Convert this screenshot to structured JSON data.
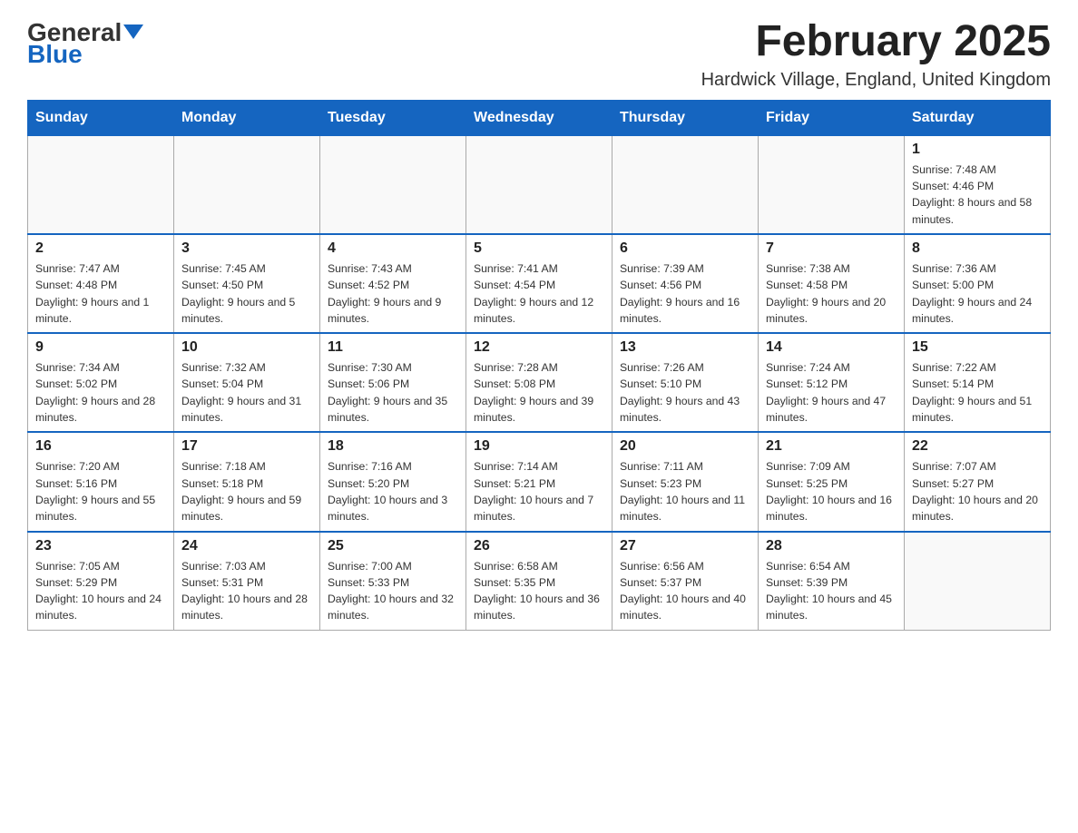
{
  "header": {
    "logo_general": "General",
    "logo_blue": "Blue",
    "month_title": "February 2025",
    "location": "Hardwick Village, England, United Kingdom"
  },
  "days_of_week": [
    "Sunday",
    "Monday",
    "Tuesday",
    "Wednesday",
    "Thursday",
    "Friday",
    "Saturday"
  ],
  "weeks": [
    [
      {
        "day": "",
        "info": ""
      },
      {
        "day": "",
        "info": ""
      },
      {
        "day": "",
        "info": ""
      },
      {
        "day": "",
        "info": ""
      },
      {
        "day": "",
        "info": ""
      },
      {
        "day": "",
        "info": ""
      },
      {
        "day": "1",
        "info": "Sunrise: 7:48 AM\nSunset: 4:46 PM\nDaylight: 8 hours and 58 minutes."
      }
    ],
    [
      {
        "day": "2",
        "info": "Sunrise: 7:47 AM\nSunset: 4:48 PM\nDaylight: 9 hours and 1 minute."
      },
      {
        "day": "3",
        "info": "Sunrise: 7:45 AM\nSunset: 4:50 PM\nDaylight: 9 hours and 5 minutes."
      },
      {
        "day": "4",
        "info": "Sunrise: 7:43 AM\nSunset: 4:52 PM\nDaylight: 9 hours and 9 minutes."
      },
      {
        "day": "5",
        "info": "Sunrise: 7:41 AM\nSunset: 4:54 PM\nDaylight: 9 hours and 12 minutes."
      },
      {
        "day": "6",
        "info": "Sunrise: 7:39 AM\nSunset: 4:56 PM\nDaylight: 9 hours and 16 minutes."
      },
      {
        "day": "7",
        "info": "Sunrise: 7:38 AM\nSunset: 4:58 PM\nDaylight: 9 hours and 20 minutes."
      },
      {
        "day": "8",
        "info": "Sunrise: 7:36 AM\nSunset: 5:00 PM\nDaylight: 9 hours and 24 minutes."
      }
    ],
    [
      {
        "day": "9",
        "info": "Sunrise: 7:34 AM\nSunset: 5:02 PM\nDaylight: 9 hours and 28 minutes."
      },
      {
        "day": "10",
        "info": "Sunrise: 7:32 AM\nSunset: 5:04 PM\nDaylight: 9 hours and 31 minutes."
      },
      {
        "day": "11",
        "info": "Sunrise: 7:30 AM\nSunset: 5:06 PM\nDaylight: 9 hours and 35 minutes."
      },
      {
        "day": "12",
        "info": "Sunrise: 7:28 AM\nSunset: 5:08 PM\nDaylight: 9 hours and 39 minutes."
      },
      {
        "day": "13",
        "info": "Sunrise: 7:26 AM\nSunset: 5:10 PM\nDaylight: 9 hours and 43 minutes."
      },
      {
        "day": "14",
        "info": "Sunrise: 7:24 AM\nSunset: 5:12 PM\nDaylight: 9 hours and 47 minutes."
      },
      {
        "day": "15",
        "info": "Sunrise: 7:22 AM\nSunset: 5:14 PM\nDaylight: 9 hours and 51 minutes."
      }
    ],
    [
      {
        "day": "16",
        "info": "Sunrise: 7:20 AM\nSunset: 5:16 PM\nDaylight: 9 hours and 55 minutes."
      },
      {
        "day": "17",
        "info": "Sunrise: 7:18 AM\nSunset: 5:18 PM\nDaylight: 9 hours and 59 minutes."
      },
      {
        "day": "18",
        "info": "Sunrise: 7:16 AM\nSunset: 5:20 PM\nDaylight: 10 hours and 3 minutes."
      },
      {
        "day": "19",
        "info": "Sunrise: 7:14 AM\nSunset: 5:21 PM\nDaylight: 10 hours and 7 minutes."
      },
      {
        "day": "20",
        "info": "Sunrise: 7:11 AM\nSunset: 5:23 PM\nDaylight: 10 hours and 11 minutes."
      },
      {
        "day": "21",
        "info": "Sunrise: 7:09 AM\nSunset: 5:25 PM\nDaylight: 10 hours and 16 minutes."
      },
      {
        "day": "22",
        "info": "Sunrise: 7:07 AM\nSunset: 5:27 PM\nDaylight: 10 hours and 20 minutes."
      }
    ],
    [
      {
        "day": "23",
        "info": "Sunrise: 7:05 AM\nSunset: 5:29 PM\nDaylight: 10 hours and 24 minutes."
      },
      {
        "day": "24",
        "info": "Sunrise: 7:03 AM\nSunset: 5:31 PM\nDaylight: 10 hours and 28 minutes."
      },
      {
        "day": "25",
        "info": "Sunrise: 7:00 AM\nSunset: 5:33 PM\nDaylight: 10 hours and 32 minutes."
      },
      {
        "day": "26",
        "info": "Sunrise: 6:58 AM\nSunset: 5:35 PM\nDaylight: 10 hours and 36 minutes."
      },
      {
        "day": "27",
        "info": "Sunrise: 6:56 AM\nSunset: 5:37 PM\nDaylight: 10 hours and 40 minutes."
      },
      {
        "day": "28",
        "info": "Sunrise: 6:54 AM\nSunset: 5:39 PM\nDaylight: 10 hours and 45 minutes."
      },
      {
        "day": "",
        "info": ""
      }
    ]
  ]
}
